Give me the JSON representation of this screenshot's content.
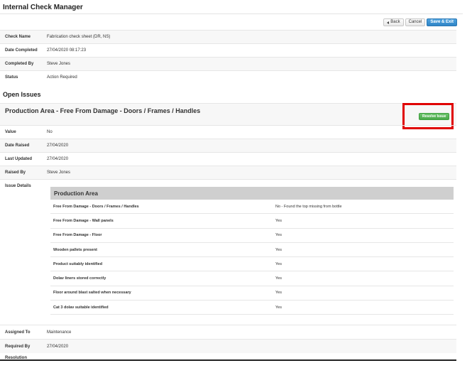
{
  "app": {
    "title": "Internal Check Manager"
  },
  "toolbar": {
    "back_label": "Back",
    "cancel_label": "Cancel",
    "save_exit_label": "Save & Exit"
  },
  "info": [
    {
      "label": "Check Name",
      "value": "Fabrication check sheet (DR, NS)"
    },
    {
      "label": "Date Completed",
      "value": "27/04/2020 08:17:23"
    },
    {
      "label": "Completed By",
      "value": "Steve Jones"
    },
    {
      "label": "Status",
      "value": "Action Required"
    }
  ],
  "open_issues": {
    "heading": "Open Issues",
    "issue_title": "Production Area - Free From Damage - Doors / Frames / Handles",
    "resolve_label": "Resolve Issue",
    "meta": [
      {
        "label": "Value",
        "value": "No"
      },
      {
        "label": "Date Raised",
        "value": "27/04/2020"
      },
      {
        "label": "Last Updated",
        "value": "27/04/2020"
      },
      {
        "label": "Raised By",
        "value": "Steve Jones"
      }
    ],
    "details_label": "Issue Details",
    "details_table": {
      "heading": "Production Area",
      "rows": [
        {
          "question": "Free From Damage - Doors / Frames / Handles",
          "answer": "No - Found the top missing from bottle"
        },
        {
          "question": "Free From Damage - Wall panels",
          "answer": "Yes"
        },
        {
          "question": "Free From Damage - Floor",
          "answer": "Yes"
        },
        {
          "question": "Wooden pallets present",
          "answer": "Yes"
        },
        {
          "question": "Product suitably identified",
          "answer": "Yes"
        },
        {
          "question": "Dolav liners stored correctly",
          "answer": "Yes"
        },
        {
          "question": "Floor around blast salted when necessary",
          "answer": "Yes"
        },
        {
          "question": "Cat 3 dolav suitable identified",
          "answer": "Yes"
        }
      ]
    },
    "footer": [
      {
        "label": "Assigned To",
        "value": "Maintenance"
      },
      {
        "label": "Required By",
        "value": "27/04/2020"
      }
    ],
    "cut_label": "Resolution"
  },
  "colors": {
    "primary": "#2f84c6",
    "success": "#4aa94a",
    "highlight": "#e00000"
  },
  "icons": {
    "back": "arrow-left-icon"
  }
}
